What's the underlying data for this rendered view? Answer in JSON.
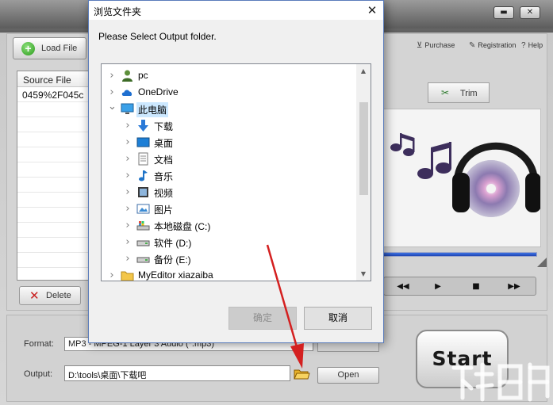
{
  "app": {
    "window_buttons": {
      "minimize": "▬",
      "close": "✕"
    },
    "load_file_label": "Load File",
    "file_list": {
      "header": "Source File",
      "rows": [
        "0459%2F045c"
      ]
    },
    "delete_label": "Delete",
    "top_links": {
      "purchase": "Purchase",
      "registration": "Registration",
      "help": "Help"
    },
    "trim_label": "Trim",
    "progress_fraction": 1.0,
    "player_buttons": [
      "◀◀",
      "▶",
      "■",
      "▶▶"
    ],
    "format": {
      "label": "Format:",
      "value": "MP3 - MPEG-1 Layer 3 Audio (*.mp3)"
    },
    "output": {
      "label": "Output:",
      "value": "D:\\tools\\桌面\\下载吧"
    },
    "open_label": "Open",
    "start_label": "Start"
  },
  "dialog": {
    "title": "浏览文件夹",
    "close_glyph": "✕",
    "prompt": "Please Select Output folder.",
    "tree": [
      {
        "label": "pc",
        "icon": "user-icon",
        "indent": 0,
        "selected": false
      },
      {
        "label": "OneDrive",
        "icon": "cloud-icon",
        "indent": 0,
        "selected": false
      },
      {
        "label": "此电脑",
        "icon": "computer-icon",
        "indent": 0,
        "selected": true,
        "expanded": true
      },
      {
        "label": "下载",
        "icon": "download-icon",
        "indent": 1,
        "selected": false
      },
      {
        "label": "桌面",
        "icon": "desktop-icon",
        "indent": 1,
        "selected": false
      },
      {
        "label": "文档",
        "icon": "document-icon",
        "indent": 1,
        "selected": false
      },
      {
        "label": "音乐",
        "icon": "music-icon",
        "indent": 1,
        "selected": false
      },
      {
        "label": "视频",
        "icon": "video-icon",
        "indent": 1,
        "selected": false
      },
      {
        "label": "图片",
        "icon": "picture-icon",
        "indent": 1,
        "selected": false
      },
      {
        "label": "本地磁盘 (C:)",
        "icon": "system-drive-icon",
        "indent": 1,
        "selected": false
      },
      {
        "label": "软件 (D:)",
        "icon": "drive-icon",
        "indent": 1,
        "selected": false
      },
      {
        "label": "备份 (E:)",
        "icon": "drive-icon",
        "indent": 1,
        "selected": false
      },
      {
        "label": "MyEditor xiazaiba",
        "icon": "folder-icon",
        "indent": 0,
        "selected": false
      }
    ],
    "ok_label": "确定",
    "cancel_label": "取消"
  },
  "colors": {
    "selection": "#cce8ff",
    "annotation_arrow": "#d42020",
    "progress": "#2a56cc"
  }
}
